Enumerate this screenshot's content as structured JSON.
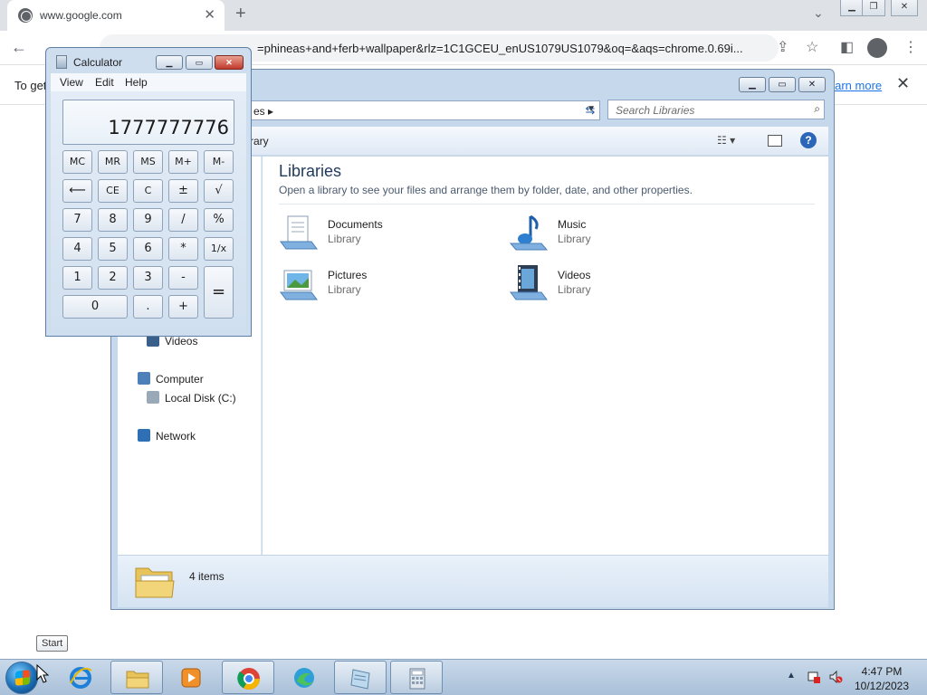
{
  "browser": {
    "tab_title": "www.google.com",
    "url": "=phineas+and+ferb+wallpaper&rlz=1C1GCEU_enUS1079US1079&oq=&aqs=chrome.0.69i...",
    "infobar_text": "To get",
    "infobar_link": "learn more"
  },
  "explorer": {
    "breadcrumb": "es",
    "search_placeholder": "Search Libraries",
    "organize_label": "rary",
    "content_title": "Libraries",
    "content_subtitle": "Open a library to see your files and arrange them by folder, date, and other properties.",
    "libraries": [
      {
        "name": "Documents",
        "kind": "Library"
      },
      {
        "name": "Music",
        "kind": "Library"
      },
      {
        "name": "Pictures",
        "kind": "Library"
      },
      {
        "name": "Videos",
        "kind": "Library"
      }
    ],
    "nav": {
      "videos": "Videos",
      "computer": "Computer",
      "local_disk": "Local Disk (C:)",
      "network": "Network"
    },
    "item_count": "4 items"
  },
  "calculator": {
    "title": "Calculator",
    "menu": [
      "View",
      "Edit",
      "Help"
    ],
    "display": "1777777776",
    "buttons": {
      "mc": "MC",
      "mr": "MR",
      "ms": "MS",
      "mplus": "M+",
      "mminus": "M-",
      "back": "⟵",
      "ce": "CE",
      "c": "C",
      "plusminus": "±",
      "sqrt": "√",
      "n7": "7",
      "n8": "8",
      "n9": "9",
      "div": "/",
      "pct": "%",
      "n4": "4",
      "n5": "5",
      "n6": "6",
      "mul": "*",
      "recip": "1/x",
      "n1": "1",
      "n2": "2",
      "n3": "3",
      "sub": "-",
      "eq": "=",
      "n0": "0",
      "dot": ".",
      "add": "+"
    }
  },
  "taskbar": {
    "start_tooltip": "Start",
    "time": "4:47 PM",
    "date": "10/12/2023"
  }
}
